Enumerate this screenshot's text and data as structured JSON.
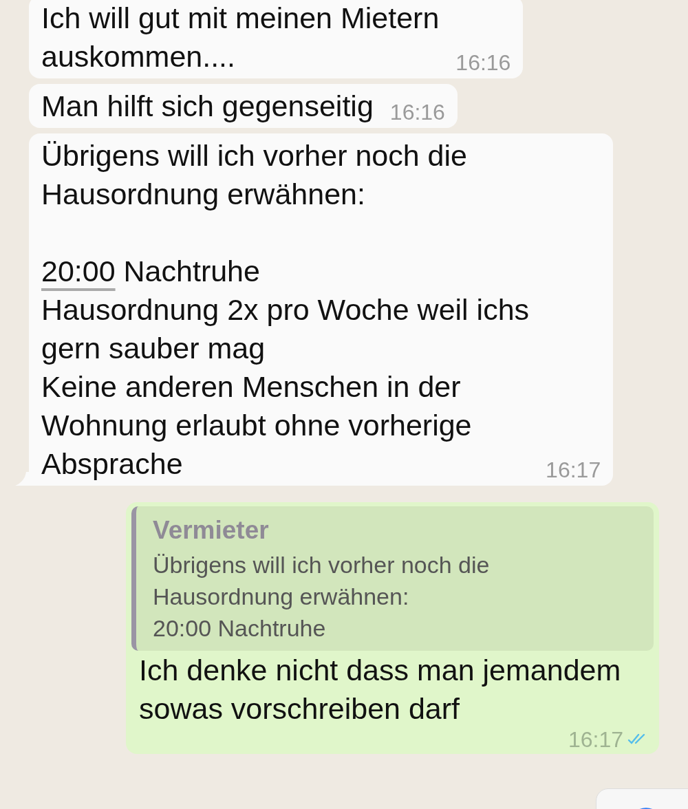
{
  "messages": [
    {
      "kind": "incoming",
      "tail": false,
      "segments": [
        {
          "kind": "text",
          "text": "Ich will gut mit meinen Mietern\nauskommen...."
        }
      ],
      "time": "16:16"
    },
    {
      "kind": "incoming",
      "tail": false,
      "segments": [
        {
          "kind": "text",
          "text": "Man hilft sich gegenseitig"
        }
      ],
      "time": "16:16"
    },
    {
      "kind": "incoming",
      "tail": true,
      "segments": [
        {
          "kind": "text",
          "text": "Übrigens will ich vorher noch die\nHausordnung erwähnen:\n\n"
        },
        {
          "kind": "link",
          "text": "20:00"
        },
        {
          "kind": "text",
          "text": " Nachtruhe\nHausordnung 2x pro Woche weil ichs\ngern sauber mag\nKeine anderen Menschen in der\nWohnung erlaubt ohne vorherige\nAbsprache"
        }
      ],
      "time": "16:17"
    },
    {
      "kind": "outgoing",
      "tail": false,
      "quote": {
        "author": "Vermieter",
        "text": "Übrigens will ich vorher noch die\nHausordnung erwähnen:\n20:00 Nachtruhe"
      },
      "segments": [
        {
          "kind": "text",
          "text": "Ich denke nicht dass man jemandem\nsowas vorschreiben darf"
        }
      ],
      "time": "16:17",
      "read": true
    }
  ]
}
